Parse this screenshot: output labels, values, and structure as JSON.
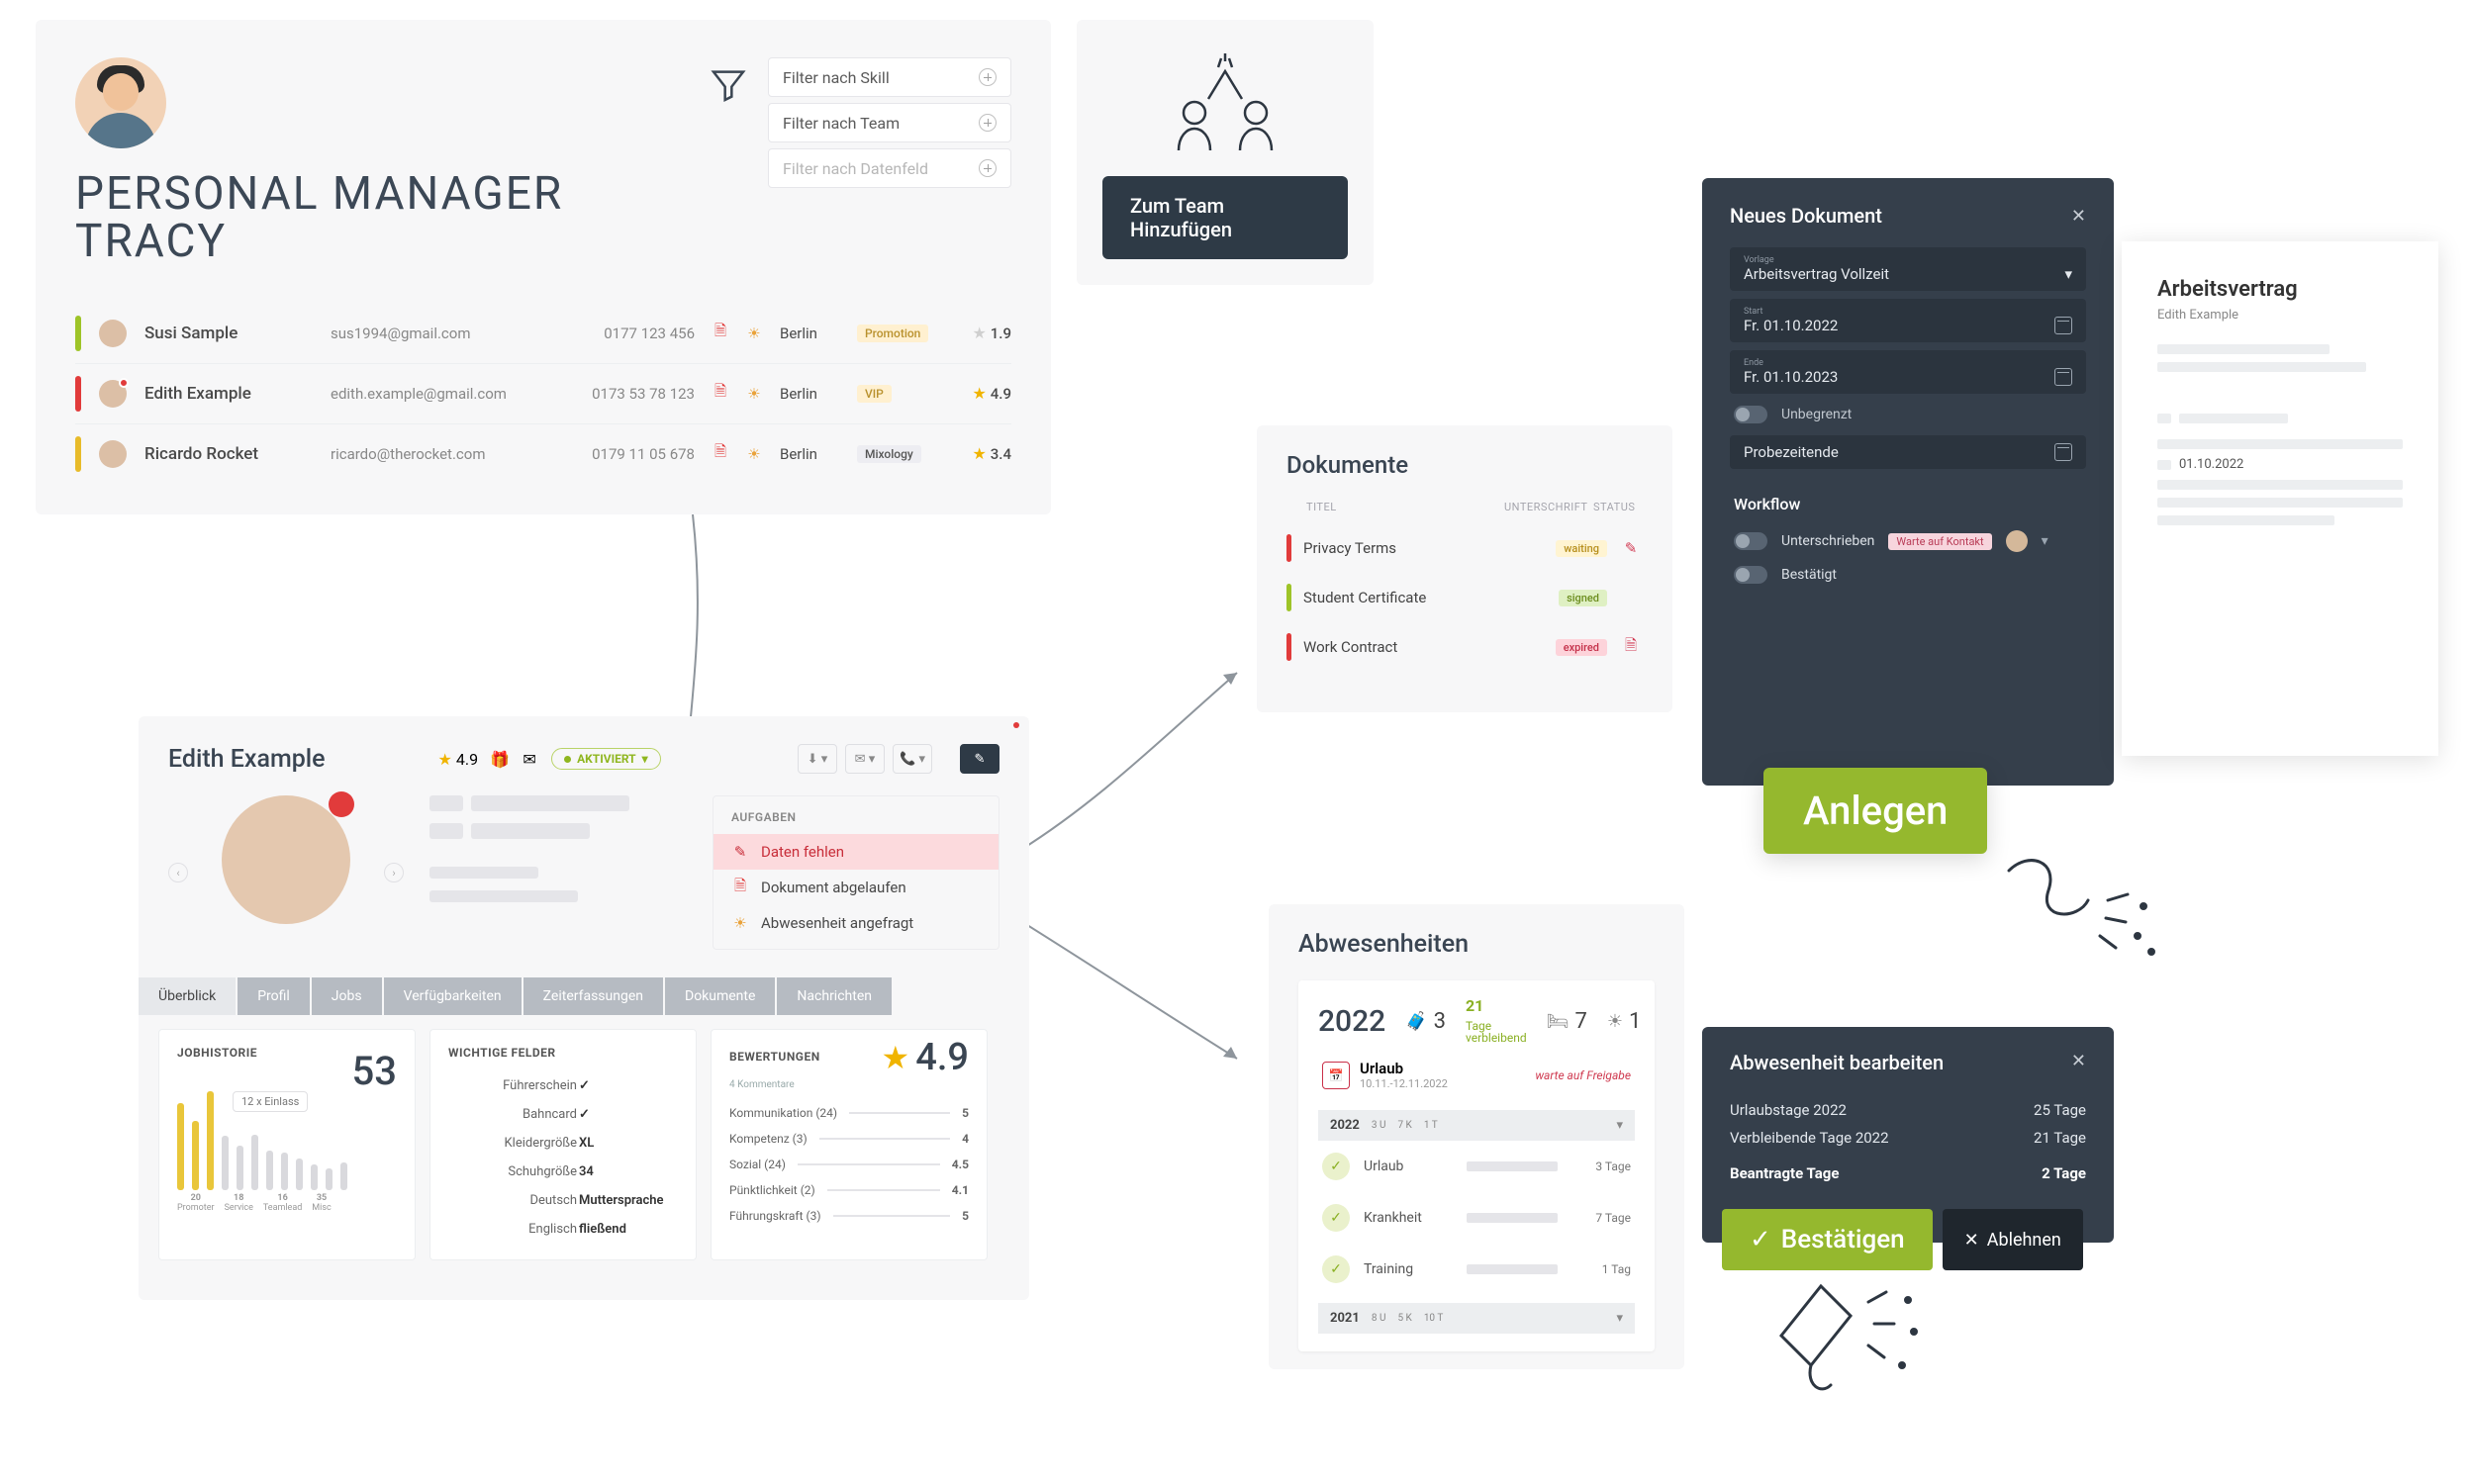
{
  "manager": {
    "title": "PERSONAL MANAGER\nTRACY",
    "filters": {
      "skill": "Filter nach Skill",
      "team": "Filter nach Team",
      "field": "Filter nach Datenfeld"
    },
    "rows": [
      {
        "marker": "green",
        "name": "Susi Sample",
        "mail": "sus1994@gmail.com",
        "phone": "0177 123 456",
        "city": "Berlin",
        "tag": "Promotion",
        "tagClass": "promotion",
        "rating": "1.9",
        "starClass": "dim"
      },
      {
        "marker": "red",
        "name": "Edith Example",
        "mail": "edith.example@gmail.com",
        "phone": "0173 53 78 123",
        "city": "Berlin",
        "tag": "VIP",
        "tagClass": "vip",
        "rating": "4.9",
        "starClass": "",
        "reddot": true
      },
      {
        "marker": "yellow",
        "name": "Ricardo Rocket",
        "mail": "ricardo@therocket.com",
        "phone": "0179 11 05 678",
        "city": "Berlin",
        "tag": "Mixology",
        "tagClass": "mixology",
        "rating": "3.4",
        "starClass": ""
      }
    ]
  },
  "team_add": {
    "button": "Zum Team Hinzufügen"
  },
  "employee": {
    "name": "Edith Example",
    "rating": "4.9",
    "status": "AKTIVIERT",
    "aufgaben": {
      "title": "AUFGABEN",
      "items": [
        "Daten fehlen",
        "Dokument abgelaufen",
        "Abwesenheit angefragt"
      ]
    },
    "tabs": [
      "Überblick",
      "Profil",
      "Jobs",
      "Verfügbarkeiten",
      "Zeiterfassungen",
      "Dokumente",
      "Nachrichten"
    ],
    "jobhist": {
      "title": "JOBHISTORIE",
      "count": "53",
      "bubble": "12 x Einlass",
      "bars": [
        88,
        70,
        100,
        55,
        45,
        56,
        40,
        38,
        32,
        26,
        22,
        28
      ],
      "labels": [
        [
          "20",
          "Promoter"
        ],
        [
          "18",
          "Service"
        ],
        [
          "16",
          "Teamlead"
        ],
        [
          "35",
          "Misc"
        ]
      ]
    },
    "fields": {
      "title": "WICHTIGE FELDER",
      "rows": [
        [
          "Führerschein",
          "✓",
          "chk"
        ],
        [
          "Bahncard",
          "✓",
          "chk"
        ],
        [
          "Kleidergröße",
          "XL",
          ""
        ],
        [
          "Schuhgröße",
          "34",
          ""
        ],
        [
          "Deutsch",
          "Muttersprache",
          ""
        ],
        [
          "Englisch",
          "fließend",
          ""
        ]
      ]
    },
    "bewert": {
      "title": "BEWERTUNGEN",
      "sub": "4 Kommentare",
      "big": "4.9",
      "rows": [
        [
          "Kommunikation (24)",
          "5"
        ],
        [
          "Kompetenz (3)",
          "4"
        ],
        [
          "Sozial (24)",
          "4.5"
        ],
        [
          "Pünktlichkeit (2)",
          "4.1"
        ],
        [
          "Führungskraft (3)",
          "5"
        ]
      ]
    }
  },
  "dokumente": {
    "title": "Dokumente",
    "head": {
      "t": "TITEL",
      "u": "UNTERSCHRIFT",
      "s": "STATUS"
    },
    "rows": [
      {
        "m": "red",
        "title": "Privacy Terms",
        "tag": "waiting",
        "tagClass": "waiting",
        "icon": "pen"
      },
      {
        "m": "green",
        "title": "Student Certificate",
        "tag": "signed",
        "tagClass": "signed",
        "icon": ""
      },
      {
        "m": "red",
        "title": "Work Contract",
        "tag": "expired",
        "tagClass": "expired",
        "icon": "doc-x"
      }
    ]
  },
  "modal_doc": {
    "title": "Neues Dokument",
    "template_lbl": "Vorlage",
    "template": "Arbeitsvertrag Vollzeit",
    "start_lbl": "Start",
    "start": "Fr. 01.10.2022",
    "end_lbl": "Ende",
    "end": "Fr. 01.10.2023",
    "unbegrenzt": "Unbegrenzt",
    "probe": "Probezeitende",
    "workflow": "Workflow",
    "wf1": "Unterschrieben",
    "wf1_tag": "Warte auf Kontakt",
    "wf2": "Bestätigt"
  },
  "page_doc": {
    "title": "Arbeitsvertrag",
    "subtitle": "Edith Example",
    "date": "01.10.2022"
  },
  "anlegen": "Anlegen",
  "abwesen": {
    "title": "Abwesenheiten",
    "year": "2022",
    "stat_used": "3",
    "stat_rem_num": "21",
    "stat_rem_lbl": "Tage\nverbleibend",
    "stat_sick": "7",
    "stat_other": "1",
    "req": {
      "name": "Urlaub",
      "date": "10.11.-12.11.2022",
      "status": "warte auf Freigabe"
    },
    "block22": {
      "yr": "2022",
      "cells": [
        "3 U",
        "7 K",
        "1 T"
      ]
    },
    "rows": [
      [
        "Urlaub",
        "3 Tage"
      ],
      [
        "Krankheit",
        "7 Tage"
      ],
      [
        "Training",
        "1 Tag"
      ]
    ],
    "block21": {
      "yr": "2021",
      "cells": [
        "8 U",
        "5 K",
        "10 T"
      ]
    }
  },
  "abs_edit": {
    "title": "Abwesenheit bearbeiten",
    "r1": [
      "Urlaubstage 2022",
      "25 Tage"
    ],
    "r2": [
      "Verbleibende Tage 2022",
      "21 Tage"
    ],
    "r3": [
      "Beantragte Tage",
      "2 Tage"
    ],
    "ok": "Bestätigen",
    "no": "Ablehnen"
  }
}
